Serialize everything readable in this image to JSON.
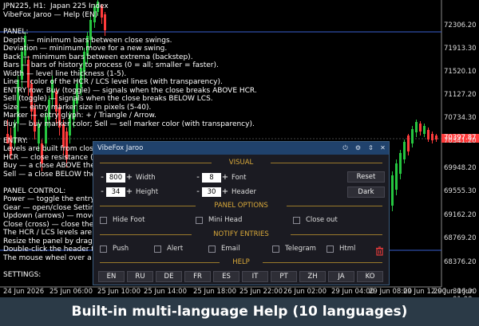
{
  "chart": {
    "title_line": "JPN225, H1:  Japan 225 Index",
    "help_title": "VibeFox Jaroo — Help (EN)",
    "current_price": "70397.87",
    "current_price_color": "#ff3b3b",
    "bull_color": "#26c540",
    "bear_color": "#ff3b3b",
    "hline_color": "#3a5fd0",
    "price_labels": [
      "72306.20",
      "71913.30",
      "71520.10",
      "71127.20",
      "70734.30",
      "70341.20",
      "69948.20",
      "69555.30",
      "69162.20",
      "68769.20",
      "68376.20"
    ],
    "time_labels": [
      "24 Jun 2026",
      "25 Jun 06:00",
      "25 Jun 10:00",
      "25 Jun 14:00",
      "25 Jun 18:00",
      "25 Jun 22:00",
      "26 Jun 02:00",
      "29 Jun 04:00",
      "29 Jun 08:00",
      "29 Jun 12:00",
      "29 Jun 16:00",
      "30 Jun 01:00"
    ]
  },
  "help_text": {
    "lines": [
      "PANEL:",
      "Depth — minimum bars between close swings.",
      "Deviation — minimum move for a new swing.",
      "Back — minimum bars between extrema (backstep).",
      "Bars — bars of history to process (0 = all; smaller = faster).",
      "Width — level line thickness (1-5).",
      "Line — color of the HCR / LCS level lines (with transparency).",
      "ENTRY row: Buy (toggle) — signals when the close breaks ABOVE HCR.",
      "Sell (toggle) — signals when the close breaks BELOW LCS.",
      "Size — entry marker size in pixels (5-40).",
      "Marker — entry glyph: + / Triangle / Arrow.",
      "Buy — buy marker color; Sell — sell marker color (with transparency).",
      "",
      "ENTRY:",
      "Levels are built from close-b",
      "HCR — close resistance (swi",
      "Buy — a close ABOVE the H",
      "Sell — a close BELOW the L",
      "",
      "PANEL CONTROL:",
      "Power — toggle the entry si",
      "Gear — open/close Settings",
      "Updown (arrows) — move t",
      "Close (cross) — close the inc",
      "The HCR / LCS levels are dr",
      "Resize the panel by draggin",
      "Double-click the header to c",
      "The mouse wheel over a Nu",
      "",
      "SETTINGS:"
    ]
  },
  "panel": {
    "title": "VibeFox Jaroo",
    "icons": [
      "power-icon",
      "gear-icon",
      "updown-icon",
      "close-icon"
    ],
    "visual": {
      "title": "VISUAL",
      "width_value": "800",
      "width_label": "Width",
      "height_value": "34",
      "height_label": "Height",
      "font_value": "8",
      "font_label": "Font",
      "header_value": "30",
      "header_label": "Header",
      "reset_label": "Reset",
      "dark_label": "Dark"
    },
    "panel_options": {
      "title": "PANEL OPTIONS",
      "hide_foot": "Hide Foot",
      "mini_head": "Mini Head",
      "close_out": "Close out"
    },
    "notify": {
      "title": "NOTIFY ENTRIES",
      "push": "Push",
      "alert": "Alert",
      "email": "Email",
      "telegram": "Telegram",
      "html": "Html"
    },
    "help": {
      "title": "HELP",
      "languages": [
        "EN",
        "RU",
        "DE",
        "FR",
        "ES",
        "IT",
        "PT",
        "ZH",
        "JA",
        "KO"
      ]
    },
    "accent_color": "#d9a93a"
  },
  "caption": "Built-in multi-language Help (10 languages)"
}
